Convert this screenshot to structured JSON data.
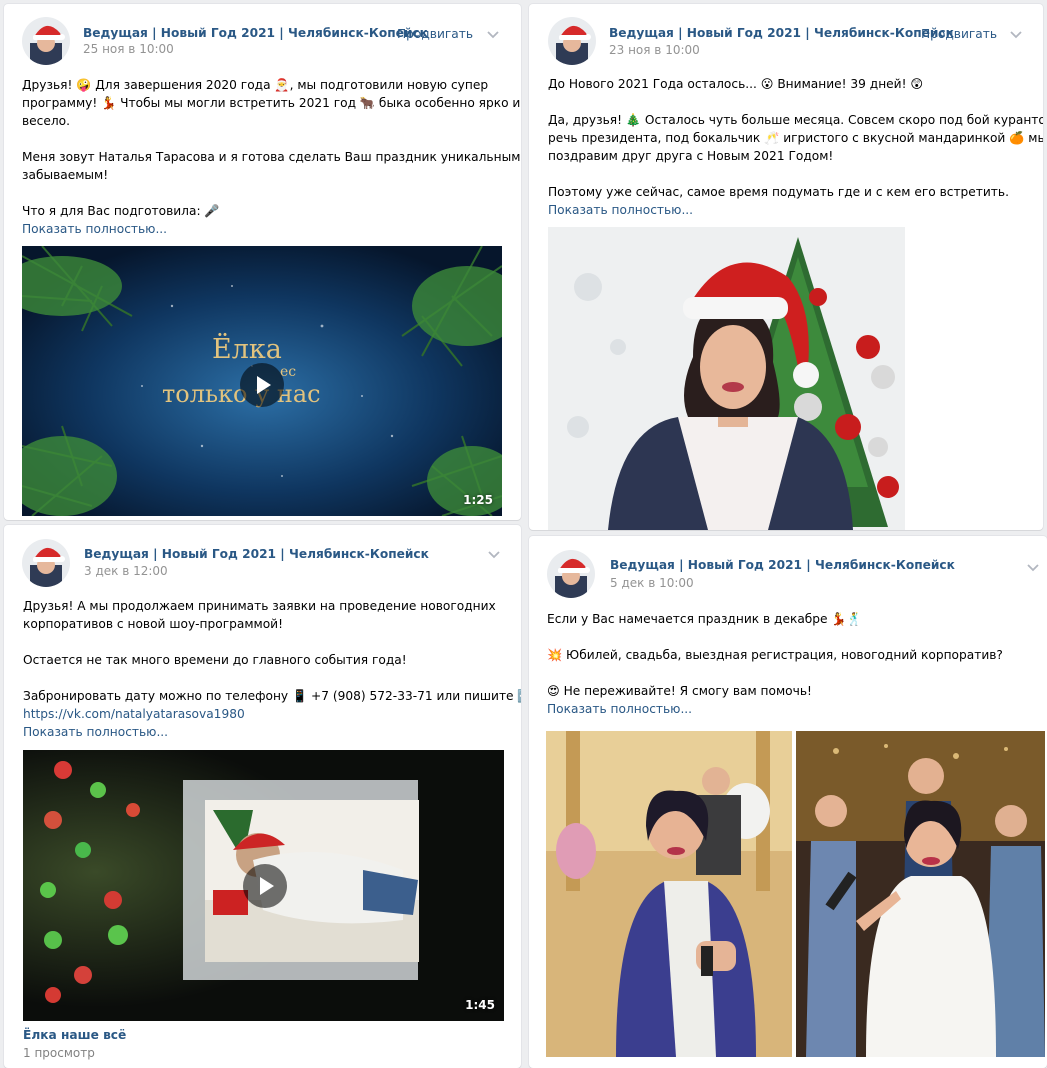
{
  "posts": [
    {
      "author": "Ведущая | Новый Год 2021 | Челябинск-Копейск",
      "date": "25 ноя в 10:00",
      "promote": "Продвигать",
      "lines": [
        "Друзья! 🤪 Для завершения 2020 года 🎅, мы подготовили новую супер",
        "программу! 💃 Чтобы мы могли встретить 2021 год 🐂 быка особенно ярко и",
        "весело.",
        "",
        "Меня зовут Наталья Тарасова и я готова сделать Ваш праздник уникальным и не",
        "забываемым!",
        "",
        "Что я для Вас подготовила: 🎤"
      ],
      "more": "Показать полностью...",
      "video": {
        "overlay_line1": "Ёлка",
        "overlay_line2": "ес",
        "overlay_line3": "только у нас",
        "duration": "1:25",
        "icon": "play-icon"
      }
    },
    {
      "author": "Ведущая | Новый Год 2021 | Челябинск-Копейск",
      "date": "23 ноя в 10:00",
      "promote": "Продвигать",
      "lines": [
        "До Нового 2021 Года осталось... 😮 Внимание! 39 дней! 😲",
        "",
        "Да, друзья! 🎄 Осталось чуть больше месяца. Совсем скоро под бой курантов и",
        "речь президента, под бокальчик 🥂 игристого с вкусной мандаринкой 🍊 мы",
        "поздравим друг друга с Новым 2021 Годом!",
        "",
        "Поэтому уже сейчас, самое время подумать где и с кем его встретить."
      ],
      "more": "Показать полностью...",
      "photo": "photo-host-santa-hat"
    },
    {
      "author": "Ведущая | Новый Год 2021 | Челябинск-Копейск",
      "date": "3 дек в 12:00",
      "lines": [
        "Друзья! А мы продолжаем принимать заявки на проведение новогодних",
        "корпоративов с новой шоу-программой!",
        "",
        "Остается не так много времени до главного события года!",
        "",
        "Забронировать дату можно по телефону 📱 +7 (908) 572-33-71 или пишите ➡️"
      ],
      "link": "https://vk.com/natalyatarasova1980",
      "more": "Показать полностью...",
      "video": {
        "duration": "1:45",
        "title": "Ёлка наше всё",
        "views": "1 просмотр",
        "icon": "play-icon"
      }
    },
    {
      "author": "Ведущая | Новый Год 2021 | Челябинск-Копейск",
      "date": "5 дек в 10:00",
      "lines": [
        "Если у Вас намечается праздник в декабре 💃🕺",
        "",
        "💥 Юбилей, свадьба, выездная регистрация, новогодний корпоратив?",
        "",
        "😍 Не переживайте! Я смогу вам помочь!"
      ],
      "more": "Показать полностью...",
      "photos": [
        "photo-wedding-host",
        "photo-party-host"
      ]
    }
  ],
  "colors": {
    "link": "#2a5885",
    "meta": "#939393",
    "background": "#edeef0"
  }
}
